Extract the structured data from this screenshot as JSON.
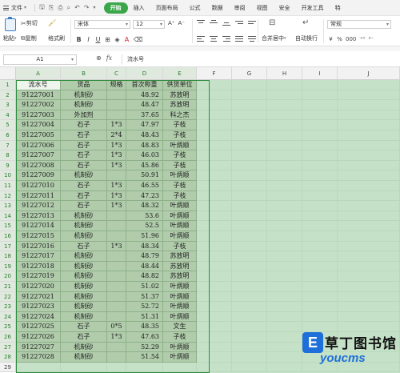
{
  "menubar": {
    "file_label": "文件",
    "tabs": [
      {
        "label": "开始",
        "active": true
      },
      {
        "label": "插入"
      },
      {
        "label": "页面布局"
      },
      {
        "label": "公式"
      },
      {
        "label": "数据"
      },
      {
        "label": "审阅"
      },
      {
        "label": "视图"
      },
      {
        "label": "安全"
      },
      {
        "label": "开发工具"
      },
      {
        "label": "特"
      }
    ]
  },
  "ribbon": {
    "cut": "剪切",
    "paste": "粘贴",
    "copy": "复制",
    "format_painter": "格式刷",
    "font_name": "宋体",
    "font_size": "12",
    "merge_center": "合并居中",
    "wrap_text": "自动换行",
    "number_format": "常规",
    "bold": "B",
    "italic": "I",
    "underline": "U",
    "font_color": "A",
    "font_size_up": "A⁺",
    "font_size_down": "A⁻",
    "currency": "¥",
    "percent": "%",
    "thousands": "000",
    "inc_decimal": "⁺⁰",
    "dec_decimal": "⁰⁻"
  },
  "formula_bar": {
    "cell_ref": "A1",
    "fx_label": "fx",
    "content": "流水号"
  },
  "grid": {
    "columns": [
      "A",
      "B",
      "C",
      "D",
      "E",
      "F",
      "G",
      "H",
      "I",
      "J"
    ],
    "row_numbers": [
      "1",
      "2",
      "3",
      "4",
      "5",
      "6",
      "7",
      "8",
      "9",
      "10",
      "11",
      "12",
      "13",
      "14",
      "15",
      "16",
      "17",
      "18",
      "19",
      "20",
      "21",
      "22",
      "23",
      "24",
      "25",
      "26",
      "27",
      "28",
      "29"
    ],
    "header": [
      "流水号",
      "货品",
      "规格",
      "首次称重",
      "供货单位"
    ],
    "rows": [
      [
        "91227001",
        "机制砂",
        "",
        "48.92",
        "苏放明"
      ],
      [
        "91227002",
        "机制砂",
        "",
        "48.47",
        "苏放明"
      ],
      [
        "91227003",
        "外加剂",
        "",
        "37.65",
        "科之杰"
      ],
      [
        "91227004",
        "石子",
        "1*3",
        "47.97",
        "子枝"
      ],
      [
        "91227005",
        "石子",
        "2*4",
        "48.43",
        "子枝"
      ],
      [
        "91227006",
        "石子",
        "1*3",
        "48.83",
        "叶炳顺"
      ],
      [
        "91227007",
        "石子",
        "1*3",
        "46.03",
        "子枝"
      ],
      [
        "91227008",
        "石子",
        "1*3",
        "45.86",
        "子枝"
      ],
      [
        "91227009",
        "机制砂",
        "",
        "50.91",
        "叶炳顺"
      ],
      [
        "91227010",
        "石子",
        "1*3",
        "46.55",
        "子枝"
      ],
      [
        "91227011",
        "石子",
        "1*3",
        "47.23",
        "子枝"
      ],
      [
        "91227012",
        "石子",
        "1*3",
        "48.32",
        "叶炳顺"
      ],
      [
        "91227013",
        "机制砂",
        "",
        "53.6",
        "叶炳顺"
      ],
      [
        "91227014",
        "机制砂",
        "",
        "52.5",
        "叶炳顺"
      ],
      [
        "91227015",
        "机制砂",
        "",
        "51.96",
        "叶炳顺"
      ],
      [
        "91227016",
        "石子",
        "1*3",
        "48.34",
        "子枝"
      ],
      [
        "91227017",
        "机制砂",
        "",
        "48.79",
        "苏放明"
      ],
      [
        "91227018",
        "机制砂",
        "",
        "48.44",
        "苏放明"
      ],
      [
        "91227019",
        "机制砂",
        "",
        "48.82",
        "苏放明"
      ],
      [
        "91227020",
        "机制砂",
        "",
        "51.02",
        "叶炳顺"
      ],
      [
        "91227021",
        "机制砂",
        "",
        "51.37",
        "叶炳顺"
      ],
      [
        "91227023",
        "机制砂",
        "",
        "52.72",
        "叶炳顺"
      ],
      [
        "91227024",
        "机制砂",
        "",
        "51.31",
        "叶炳顺"
      ],
      [
        "91227025",
        "石子",
        "0*5",
        "48.35",
        "文生"
      ],
      [
        "91227026",
        "石子",
        "1*3",
        "47.63",
        "子枝"
      ],
      [
        "91227027",
        "机制砂",
        "",
        "52.29",
        "叶炳顺"
      ],
      [
        "91227028",
        "机制砂",
        "",
        "51.54",
        "叶炳顺"
      ]
    ]
  },
  "watermark": {
    "logo_letter": "E",
    "cn_text": "草丁图书馆",
    "en_text": "youcms"
  }
}
